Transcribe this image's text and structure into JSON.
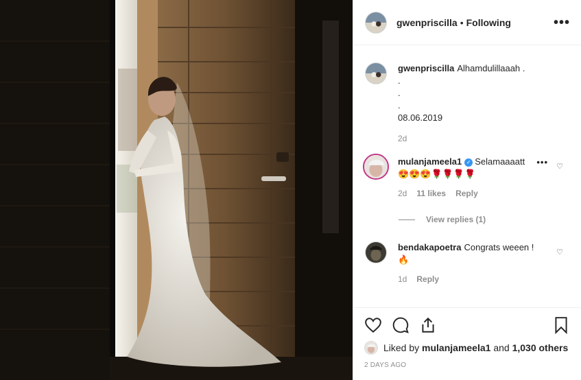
{
  "post": {
    "username": "gwenpriscilla",
    "separator": "•",
    "follow_status": "Following",
    "more_label": "•••"
  },
  "caption": {
    "username": "gwenpriscilla",
    "lines": [
      "Alhamdulillaaah .",
      ".",
      ".",
      ".",
      "08.06.2019"
    ],
    "time": "2d"
  },
  "comments": [
    {
      "username": "mulanjameela1",
      "verified": true,
      "text": "Selamaaaatt",
      "emojis": "😍😍😍🌹🌹🌹🌹",
      "time": "2d",
      "likes": "11 likes",
      "reply_label": "Reply",
      "more_label": "•••",
      "view_replies": "View replies (1)"
    },
    {
      "username": "bendakapoetra",
      "text": "Congrats weeen !",
      "emojis": "🔥",
      "time": "1d",
      "reply_label": "Reply"
    }
  ],
  "actions": {
    "liked_by_prefix": "Liked by",
    "liked_by_user": "mulanjameela1",
    "liked_by_joiner": "and",
    "liked_by_count": "1,030 others",
    "posted_ago": "2 DAYS AGO",
    "icons": [
      "heart-icon",
      "comment-icon",
      "share-icon",
      "bookmark-icon"
    ]
  },
  "colors": {
    "text": "#262626",
    "muted": "#8e8e8e",
    "border": "#efefef",
    "verified": "#3897f0"
  }
}
